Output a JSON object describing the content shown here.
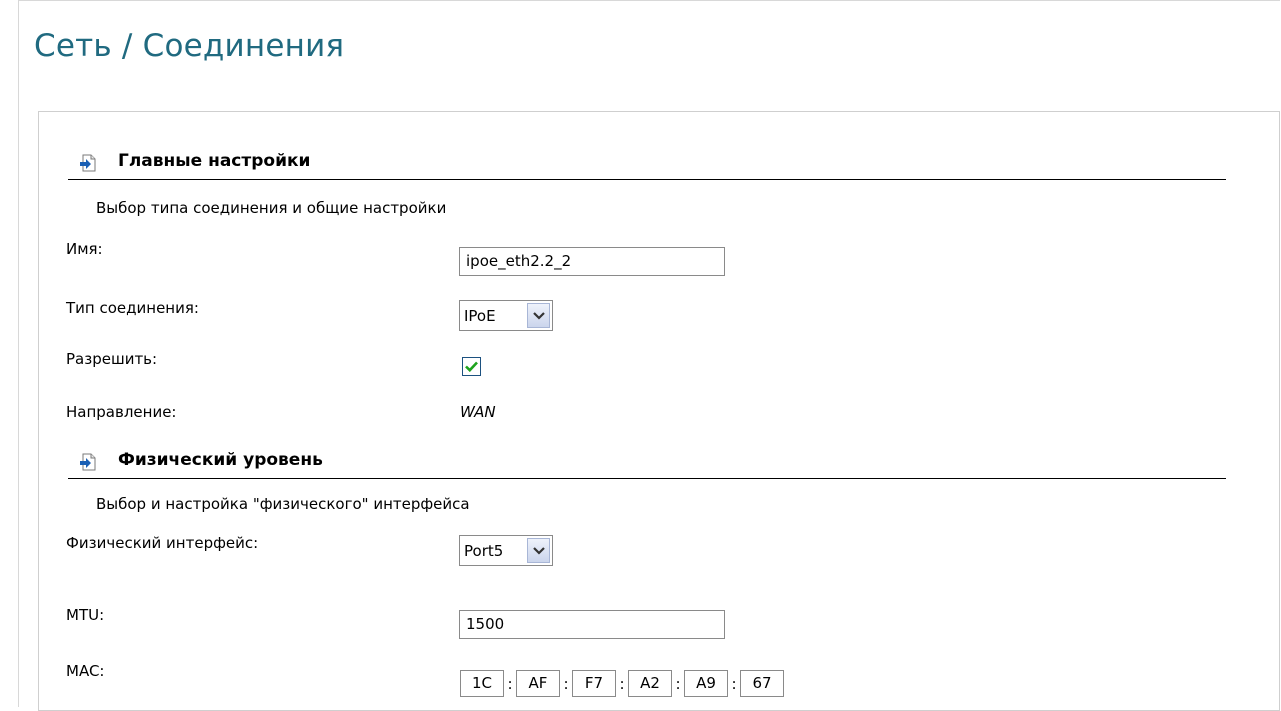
{
  "page": {
    "title": "Сеть / Соединения"
  },
  "main_settings": {
    "heading": "Главные настройки",
    "description": "Выбор типа соединения и общие настройки",
    "name_label": "Имя:",
    "name_value": "ipoe_eth2.2_2",
    "connection_type_label": "Тип соединения:",
    "connection_type_value": "IPoE",
    "enable_label": "Разрешить:",
    "enable_checked": true,
    "direction_label": "Направление:",
    "direction_value": "WAN"
  },
  "physical_level": {
    "heading": "Физический уровень",
    "description": "Выбор и настройка \"физического\" интерфейса",
    "interface_label": "Физический интерфейс:",
    "interface_value": "Port5",
    "mtu_label": "MTU:",
    "mtu_value": "1500",
    "mac_label": "MAC:",
    "mac_octets": [
      "1C",
      "AF",
      "F7",
      "A2",
      "A9",
      "67"
    ],
    "mac_separator": ":"
  },
  "colors": {
    "title": "#206a80",
    "check": "#1ea31e",
    "arrow_icon": "#1a5fb4"
  }
}
